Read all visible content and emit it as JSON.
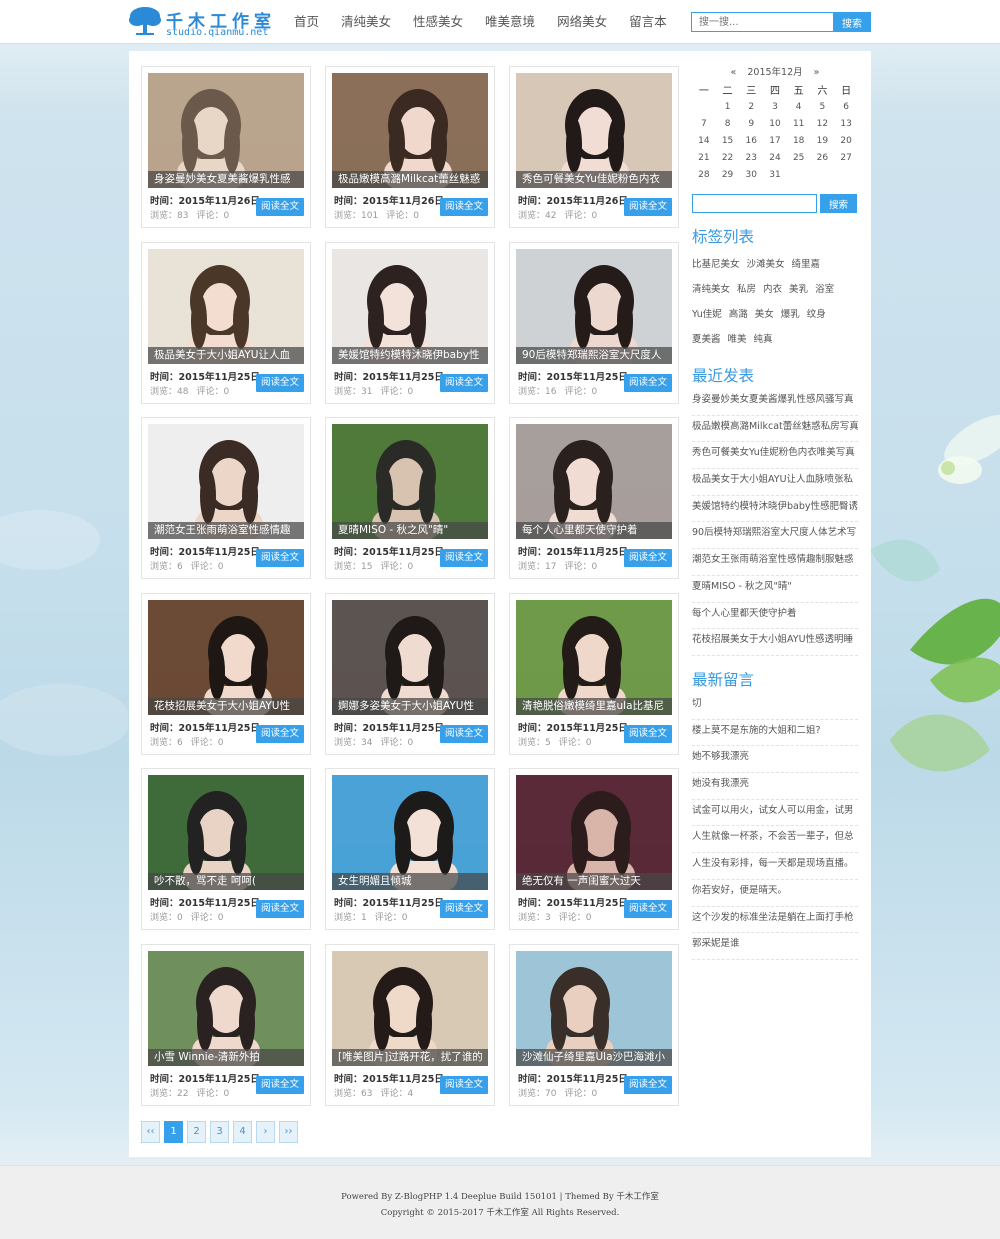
{
  "logo": {
    "title": "千木工作室",
    "url": "studio.qianmu.net"
  },
  "nav": [
    "首页",
    "清纯美女",
    "性感美女",
    "唯美意境",
    "网络美女",
    "留言本"
  ],
  "search": {
    "placeholder": "搜一搜...",
    "button": "搜索"
  },
  "posts": [
    {
      "title": "身姿曼妙美女夏美酱爆乳性感",
      "date_label": "时间：",
      "date": "2015年11月26日",
      "views_label": "浏览：",
      "views": "83",
      "comments_label": "评论：",
      "comments": "0",
      "read": "阅读全文",
      "colors": [
        "#b9a48d",
        "#6b5a4c",
        "#e8d6c6"
      ]
    },
    {
      "title": "极品嫩模高潞Milkcat蕾丝魅惑",
      "date_label": "时间：",
      "date": "2015年11月26日",
      "views_label": "浏览：",
      "views": "101",
      "comments_label": "评论：",
      "comments": "0",
      "read": "阅读全文",
      "colors": [
        "#8b6f58",
        "#3b2a22",
        "#f0d9cc"
      ]
    },
    {
      "title": "秀色可餐美女Yu佳妮粉色内衣",
      "date_label": "时间：",
      "date": "2015年11月26日",
      "views_label": "浏览：",
      "views": "42",
      "comments_label": "评论：",
      "comments": "0",
      "read": "阅读全文",
      "colors": [
        "#d7c7b6",
        "#221a18",
        "#f1ddd3"
      ]
    },
    {
      "title": "极品美女于大小姐AYU让人血",
      "date_label": "时间：",
      "date": "2015年11月25日",
      "views_label": "浏览：",
      "views": "48",
      "comments_label": "评论：",
      "comments": "0",
      "read": "阅读全文",
      "colors": [
        "#e8e3d6",
        "#4a3728",
        "#f2ddd0"
      ]
    },
    {
      "title": "美媛馆特约模特沐晓伊baby性",
      "date_label": "时间：",
      "date": "2015年11月25日",
      "views_label": "浏览：",
      "views": "31",
      "comments_label": "评论：",
      "comments": "0",
      "read": "阅读全文",
      "colors": [
        "#e9e6e4",
        "#2e2220",
        "#f3e2da"
      ]
    },
    {
      "title": "90后模特郑瑞熙浴室大尺度人",
      "date_label": "时间：",
      "date": "2015年11月25日",
      "views_label": "浏览：",
      "views": "16",
      "comments_label": "评论：",
      "comments": "0",
      "read": "阅读全文",
      "colors": [
        "#cfd2d4",
        "#251c1a",
        "#ecd8cf"
      ]
    },
    {
      "title": "潮范女王张雨萌浴室性感情趣",
      "date_label": "时间：",
      "date": "2015年11月25日",
      "views_label": "浏览：",
      "views": "6",
      "comments_label": "评论：",
      "comments": "0",
      "read": "阅读全文",
      "colors": [
        "#eeeeee",
        "#3a2b24",
        "#ecd6c8"
      ]
    },
    {
      "title": "夏晴MISO - 秋之风\"晴\"",
      "date_label": "时间：",
      "date": "2015年11月25日",
      "views_label": "浏览：",
      "views": "15",
      "comments_label": "评论：",
      "comments": "0",
      "read": "阅读全文",
      "colors": [
        "#4f7a3a",
        "#2a2a26",
        "#d8c2b0"
      ]
    },
    {
      "title": "每个人心里都天使守护着",
      "date_label": "时间：",
      "date": "2015年11月25日",
      "views_label": "浏览：",
      "views": "17",
      "comments_label": "评论：",
      "comments": "0",
      "read": "阅读全文",
      "colors": [
        "#a79f9c",
        "#2a211f",
        "#f0dcd2"
      ]
    },
    {
      "title": "花枝招展美女于大小姐AYU性",
      "date_label": "时间：",
      "date": "2015年11月25日",
      "views_label": "浏览：",
      "views": "6",
      "comments_label": "评论：",
      "comments": "0",
      "read": "阅读全文",
      "colors": [
        "#6b4a36",
        "#1e1714",
        "#f1d9cb"
      ]
    },
    {
      "title": "婀娜多姿美女于大小姐AYU性",
      "date_label": "时间：",
      "date": "2015年11月25日",
      "views_label": "浏览：",
      "views": "34",
      "comments_label": "评论：",
      "comments": "0",
      "read": "阅读全文",
      "colors": [
        "#5c5450",
        "#1f1a18",
        "#f0dbd1"
      ]
    },
    {
      "title": "清艳脱俗嫩模绮里嘉ula比基尼",
      "date_label": "时间：",
      "date": "2015年11月25日",
      "views_label": "浏览：",
      "views": "5",
      "comments_label": "评论：",
      "comments": "0",
      "read": "阅读全文",
      "colors": [
        "#6e9a4a",
        "#231b18",
        "#efd8ca"
      ]
    },
    {
      "title": "吵不散，骂不走 呵呵(",
      "date_label": "时间：",
      "date": "2015年11月25日",
      "views_label": "浏览：",
      "views": "0",
      "comments_label": "评论：",
      "comments": "0",
      "read": "阅读全文",
      "colors": [
        "#3f6a3a",
        "#222",
        "#e8d3c4"
      ]
    },
    {
      "title": "女生明媚且倾城",
      "date_label": "时间：",
      "date": "2015年11月25日",
      "views_label": "浏览：",
      "views": "1",
      "comments_label": "评论：",
      "comments": "0",
      "read": "阅读全文",
      "colors": [
        "#4aa2d6",
        "#1d1a1a",
        "#f3e0d6"
      ]
    },
    {
      "title": "绝无仅有 一声闺蜜大过天",
      "date_label": "时间：",
      "date": "2015年11月25日",
      "views_label": "浏览：",
      "views": "3",
      "comments_label": "评论：",
      "comments": "0",
      "read": "阅读全文",
      "colors": [
        "#5a2a38",
        "#2c1c1c",
        "#d9b4a8"
      ]
    },
    {
      "title": "小雪 Winnie-清新外拍",
      "date_label": "时间：",
      "date": "2015年11月25日",
      "views_label": "浏览：",
      "views": "22",
      "comments_label": "评论：",
      "comments": "0",
      "read": "阅读全文",
      "colors": [
        "#6f8f5c",
        "#2a2220",
        "#efd9cd"
      ]
    },
    {
      "title": "[唯美图片]过路开花，扰了谁的",
      "date_label": "时间：",
      "date": "2015年11月25日",
      "views_label": "浏览：",
      "views": "63",
      "comments_label": "评论：",
      "comments": "4",
      "read": "阅读全文",
      "colors": [
        "#d8c9b4",
        "#241b18",
        "#efd9c9"
      ]
    },
    {
      "title": "沙滩仙子绮里嘉Ula沙巴海滩小",
      "date_label": "时间：",
      "date": "2015年11月25日",
      "views_label": "浏览：",
      "views": "70",
      "comments_label": "评论：",
      "comments": "0",
      "read": "阅读全文",
      "colors": [
        "#9ec4d8",
        "#3a2e28",
        "#e9cfbf"
      ]
    }
  ],
  "pager": [
    "‹‹",
    "1",
    "2",
    "3",
    "4",
    "›",
    "››"
  ],
  "calendar": {
    "prev": "«",
    "month": "2015年12月",
    "next": "»",
    "weekdays": [
      "一",
      "二",
      "三",
      "四",
      "五",
      "六",
      "日"
    ],
    "weeks": [
      [
        "",
        "1",
        "2",
        "3",
        "4",
        "5",
        "6"
      ],
      [
        "7",
        "8",
        "9",
        "10",
        "11",
        "12",
        "13"
      ],
      [
        "14",
        "15",
        "16",
        "17",
        "18",
        "19",
        "20"
      ],
      [
        "21",
        "22",
        "23",
        "24",
        "25",
        "26",
        "27"
      ],
      [
        "28",
        "29",
        "30",
        "31",
        "",
        "",
        ""
      ]
    ]
  },
  "sidebar_search": {
    "button": "搜索"
  },
  "tags": {
    "title": "标签列表",
    "rows": [
      [
        "比基尼美女",
        "沙滩美女",
        "绮里嘉"
      ],
      [
        "清纯美女",
        "私房",
        "内衣",
        "美乳",
        "浴室"
      ],
      [
        "Yu佳妮",
        "高潞",
        "美女",
        "爆乳",
        "纹身"
      ],
      [
        "夏美酱",
        "唯美",
        "纯真"
      ]
    ]
  },
  "recent": {
    "title": "最近发表",
    "items": [
      "身姿曼妙美女夏美酱爆乳性感风骚写真",
      "极品嫩模高潞Milkcat蕾丝魅惑私房写真",
      "秀色可餐美女Yu佳妮粉色内衣唯美写真",
      "极品美女于大小姐AYU让人血脉喷张私",
      "美媛馆特约模特沐晓伊baby性感肥臀诱",
      "90后模特郑瑞熙浴室大尺度人体艺术写",
      "潮范女王张雨萌浴室性感情趣制服魅惑",
      "夏晴MISO - 秋之风\"晴\"",
      "每个人心里都天使守护着",
      "花枝招展美女于大小姐AYU性感透明睡"
    ]
  },
  "comments": {
    "title": "最新留言",
    "items": [
      "切",
      "楼上莫不是东施的大姐和二姐?",
      "她不够我漂亮",
      "她没有我漂亮",
      "试金可以用火，试女人可以用金，试男",
      "人生就像一杯茶，不会苦一辈子，但总",
      "人生没有彩排，每一天都是现场直播。",
      "你若安好，便是晴天。",
      "这个沙发的标准坐法是躺在上面打手枪",
      "郭采妮是谁"
    ]
  },
  "footer": {
    "line1": "Powered By Z-BlogPHP 1.4 Deeplue Build 150101 | Themed By 千木工作室",
    "line2": "Copyright © 2015-2017 千木工作室 All Rights Reserved."
  },
  "colors": {
    "accent": "#36a0ea",
    "title_blue": "#3a9ae0"
  }
}
